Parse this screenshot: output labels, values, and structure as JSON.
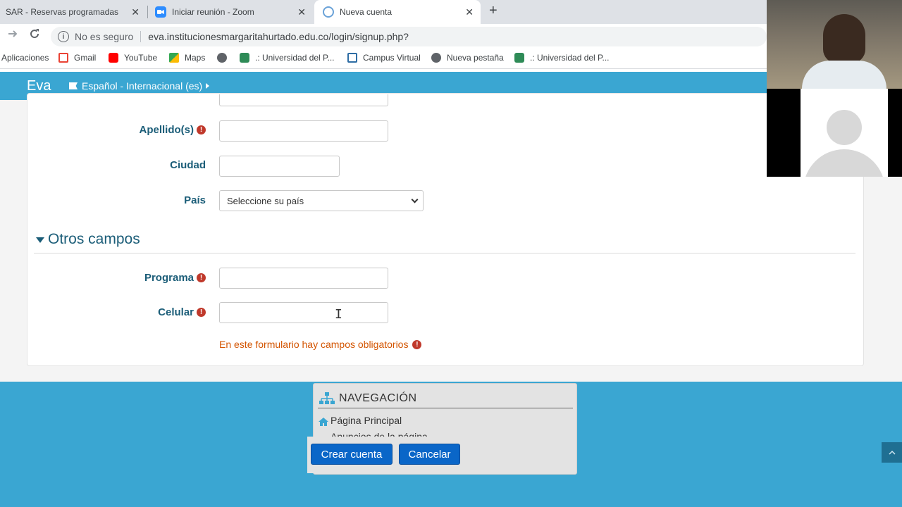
{
  "browser": {
    "tabs": [
      {
        "title": "SAR - Reservas programadas"
      },
      {
        "title": "Iniciar reunión - Zoom"
      },
      {
        "title": "Nueva cuenta"
      }
    ],
    "close_glyph": "✕",
    "new_tab_glyph": "+",
    "security_label": "No es seguro",
    "url": "eva.institucionesmargaritahurtado.edu.co/login/signup.php?",
    "bookmarks": [
      "Aplicaciones",
      "Gmail",
      "YouTube",
      "Maps",
      ".: Universidad del P...",
      "Campus Virtual",
      "Nueva pestaña",
      ".: Universidad del P..."
    ]
  },
  "navbar": {
    "brand": "Eva",
    "language": "Español - Internacional (es)"
  },
  "form": {
    "fields": {
      "apellidos": "Apellido(s)",
      "ciudad": "Ciudad",
      "pais": "País",
      "programa": "Programa",
      "celular": "Celular"
    },
    "pais_selected": "Seleccione su país",
    "section_title": "Otros campos",
    "required_note": "En este formulario hay campos obligatorios",
    "required_glyph": "!"
  },
  "footer": {
    "nav_title": "NAVEGACIÓN",
    "nav_items": [
      "Página Principal",
      "Anuncios de la página"
    ],
    "create_button": "Crear cuenta",
    "cancel_button": "Cancelar"
  },
  "colors": {
    "navbar": "#3aa6d2",
    "label": "#1b5d78",
    "required": "#c0392b",
    "button": "#0a66c8"
  }
}
